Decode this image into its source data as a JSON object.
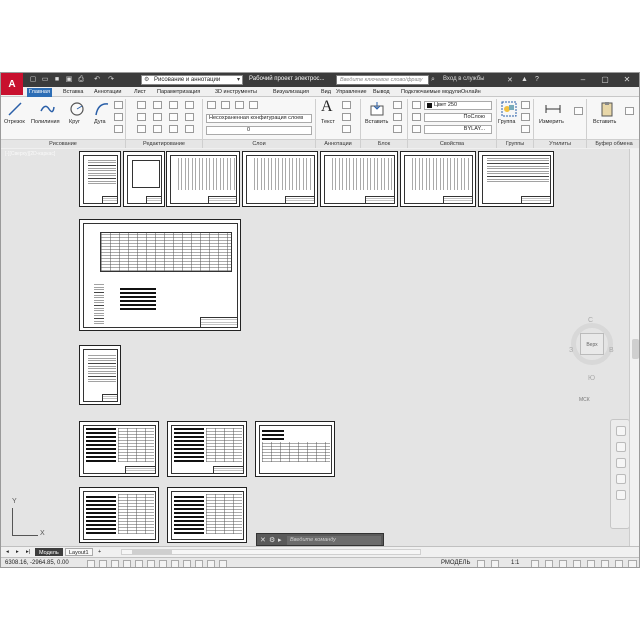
{
  "title_bar": {
    "logo": "A",
    "quick_access_icons": [
      "new-icon",
      "open-icon",
      "save-icon",
      "saveas-icon",
      "print-icon",
      "undo-icon",
      "redo-icon"
    ],
    "workspace": "Рисование и аннотации",
    "document_title": "Рабочий проект электрос...",
    "search_placeholder": "Введите ключевое слово/фразу",
    "signin": "Вход в службы",
    "window_controls": [
      "minimize-icon",
      "maximize-icon",
      "close-icon"
    ]
  },
  "ribbon_tabs": [
    "Главная",
    "Вставка",
    "Аннотации",
    "Лист",
    "Параметризация",
    "3D инструменты",
    "Визуализация",
    "Вид",
    "Управление",
    "Вывод",
    "Подключаемые модули",
    "Онлайн"
  ],
  "ribbon": {
    "draw": {
      "tools": [
        "Отрезок",
        "Полилиния",
        "Круг",
        "Дуга"
      ],
      "title": "Рисование"
    },
    "modify": {
      "title": "Редактирование"
    },
    "layers": {
      "config": "Несохраненная конфигурация слоев",
      "current": "0",
      "title": "Слои"
    },
    "annotation": {
      "text": "Текст",
      "title": "Аннотации"
    },
    "block": {
      "insert": "Вставить",
      "title": "Блок"
    },
    "properties": {
      "color": "Цвет 250",
      "linetype": "ПоСлою",
      "lineweight": "BYLAY...",
      "title": "Свойства"
    },
    "groups": {
      "label": "Группа",
      "title": "Группы"
    },
    "utilities": {
      "label": "Измерить",
      "title": "Утилиты"
    },
    "clipboard": {
      "label": "Вставить",
      "title": "Буфер обмена"
    }
  },
  "canvas": {
    "viewport_label": "[-][Сверху][2D-каркас]",
    "viewcube": {
      "top": "Верх",
      "north": "С",
      "south": "Ю",
      "west": "З",
      "east": "В",
      "wcs": "МСК"
    },
    "ucs": {
      "x": "X",
      "y": "Y"
    }
  },
  "layout_tabs": [
    "Модель",
    "Layout1"
  ],
  "command_line": {
    "placeholder": "Введите команду"
  },
  "status_bar": {
    "coords": "6308.16, -2964.85, 0.00",
    "mode": "РМОДЕЛЬ",
    "scale": "1:1"
  }
}
